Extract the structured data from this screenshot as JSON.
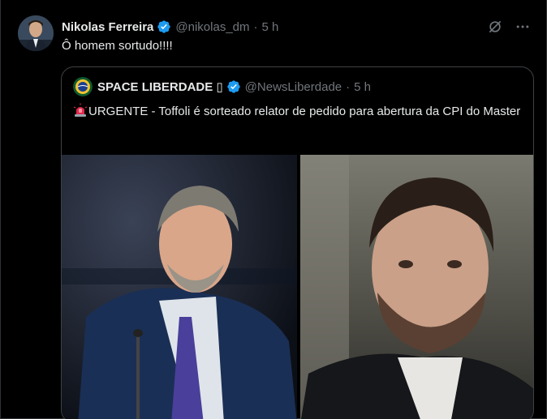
{
  "tweet": {
    "author_name": "Nikolas Ferreira",
    "handle": "@nikolas_dm",
    "separator": "·",
    "time": "5 h",
    "text": "Ô homem sortudo!!!!"
  },
  "quote": {
    "author_name": "SPACE LIBERDADE ▯",
    "handle": "@NewsLiberdade",
    "separator": "·",
    "time": "5 h",
    "text": "URGENTE - Toffoli é sorteado relator de pedido para abertura da CPI do Master",
    "siren_icon": "police-light-emoji"
  },
  "icons": {
    "grok": "grok-icon",
    "more": "more-options-icon",
    "verified": "verified-badge-icon"
  },
  "colors": {
    "background": "#000000",
    "text": "#e7e9ea",
    "secondary_text": "#71767b",
    "verified_blue": "#1d9bf0",
    "border": "#3e4144"
  }
}
